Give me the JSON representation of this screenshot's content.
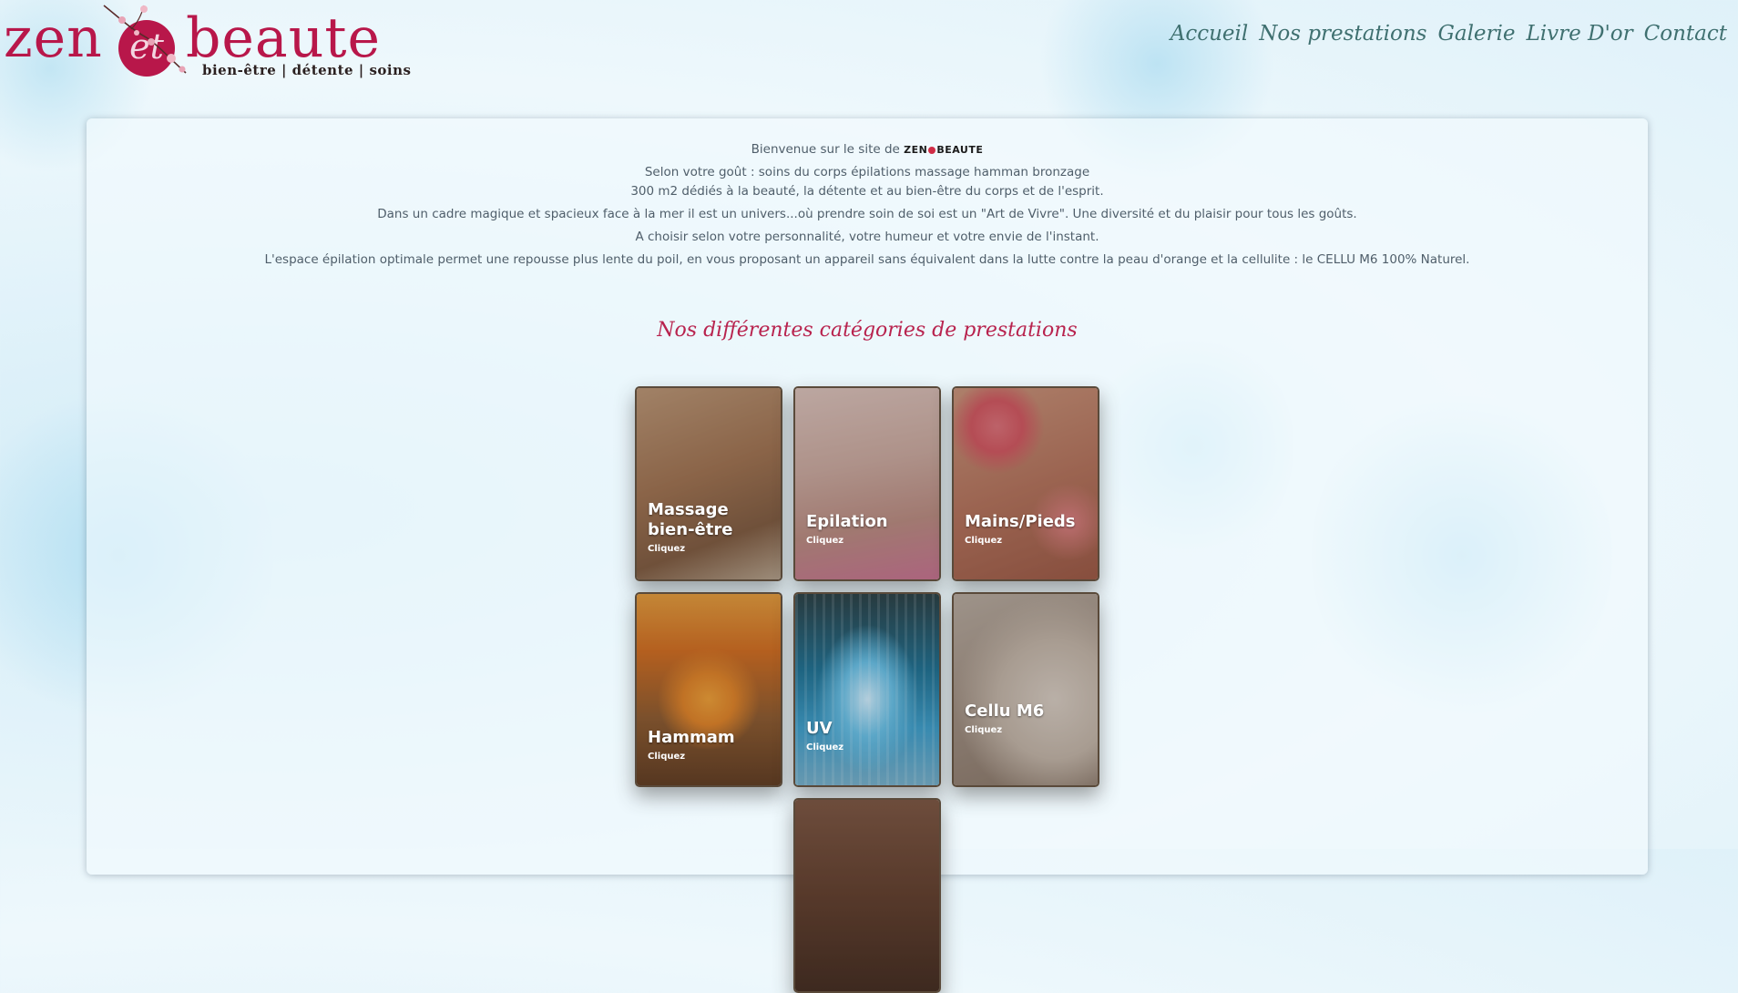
{
  "brand": {
    "name_left": "zen",
    "name_mid": "et",
    "name_right": "beaute",
    "tagline": "bien-être | détente | soins",
    "mini_left": "ZEN",
    "mini_right": "BEAUTE",
    "color": "#b8174a"
  },
  "nav": {
    "items": [
      "Accueil",
      "Nos prestations",
      "Galerie",
      "Livre D'or",
      "Contact"
    ]
  },
  "intro": {
    "welcome": "Bienvenue sur le site de",
    "lines": [
      "Selon votre goût : soins du corps épilations massage hamman bronzage",
      "300 m2 dédiés à la beauté, la détente et au bien-être du corps et de l'esprit.",
      "Dans un cadre magique et spacieux face à la mer il est un univers...où prendre soin de soi est un \"Art de Vivre\". Une diversité et du plaisir pour tous les goûts.",
      "A choisir selon votre personnalité, votre humeur et votre envie de l'instant.",
      "L'espace épilation optimale permet une repousse plus lente du poil, en vous proposant un appareil sans équivalent dans la lutte contre la peau d'orange et la cellulite : le CELLU M6 100% Naturel."
    ]
  },
  "section": {
    "title": "Nos différentes catégories de prestations"
  },
  "categories": [
    {
      "title": "Massage bien-être",
      "cta": "Cliquez",
      "image": "massage-photo",
      "color": "#b8906e"
    },
    {
      "title": "Epilation",
      "cta": "Cliquez",
      "image": "epilation-photo",
      "color": "#c9a8a0"
    },
    {
      "title": "Mains/Pieds",
      "cta": "Cliquez",
      "image": "hands-flower-photo",
      "color": "#b87862"
    },
    {
      "title": "Hammam",
      "cta": "Cliquez",
      "image": "candles-photo",
      "color": "#c8782a"
    },
    {
      "title": "UV",
      "cta": "Cliquez",
      "image": "tanning-bed-photo",
      "color": "#3c7a98"
    },
    {
      "title": "Cellu M6",
      "cta": "Cliquez",
      "image": "body-photo",
      "color": "#9a8a80"
    },
    {
      "title": "",
      "cta": "",
      "image": "product-photo",
      "color": "#6b4a38"
    }
  ]
}
